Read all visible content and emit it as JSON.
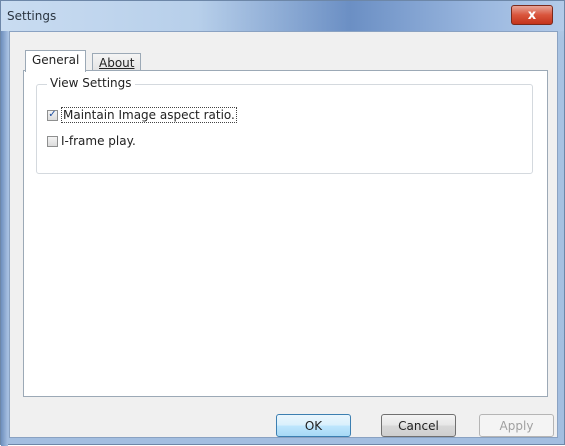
{
  "window": {
    "title": "Settings",
    "close_glyph": "x"
  },
  "tabs": [
    {
      "label": "General",
      "active": true
    },
    {
      "label": "About",
      "active": false
    }
  ],
  "view_settings": {
    "group_title": "View Settings",
    "options": [
      {
        "label": "Maintain Image aspect ratio.",
        "checked": true
      },
      {
        "label": "I-frame play.",
        "checked": false
      }
    ]
  },
  "buttons": {
    "ok": "OK",
    "cancel": "Cancel",
    "apply": "Apply"
  },
  "icons": {
    "close": "close-icon",
    "check": "checkmark-icon"
  },
  "colors": {
    "close_button": "#d9553c",
    "ok_button_border": "#3c7fb1"
  }
}
